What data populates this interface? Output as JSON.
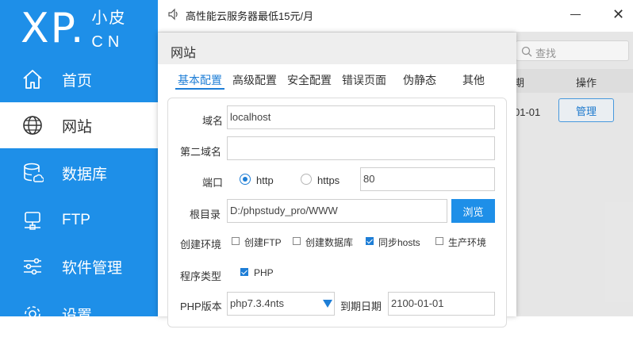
{
  "logo": {
    "main": "XP.",
    "cn_top": "小皮",
    "cn_bottom": "CN"
  },
  "sidebar": {
    "items": [
      {
        "label": "首页",
        "icon": "home-icon",
        "active": false
      },
      {
        "label": "网站",
        "icon": "globe-icon",
        "active": true
      },
      {
        "label": "数据库",
        "icon": "database-icon",
        "active": false
      },
      {
        "label": "FTP",
        "icon": "server-icon",
        "active": false
      },
      {
        "label": "软件管理",
        "icon": "sliders-icon",
        "active": false
      },
      {
        "label": "设置",
        "icon": "gear-icon",
        "active": false
      }
    ]
  },
  "topbar": {
    "notice": "高性能云服务器最低15元/月",
    "speaker_icon": "speaker-icon",
    "minimize_icon": "minimize-icon",
    "close_icon": "close-icon"
  },
  "background": {
    "search_placeholder": "查找",
    "col_date": "期",
    "col_op": "操作",
    "row_date": "01-01",
    "manage_label": "管理"
  },
  "dialog": {
    "title": "网站",
    "tabs": [
      "基本配置",
      "高级配置",
      "安全配置",
      "错误页面",
      "伪静态",
      "其他"
    ],
    "active_tab": 0,
    "form": {
      "domain_label": "域名",
      "domain_value": "localhost",
      "second_domain_label": "第二域名",
      "second_domain_value": "",
      "port_label": "端口",
      "protocol_http": "http",
      "protocol_https": "https",
      "protocol_selected": "http",
      "port_value": "80",
      "root_label": "根目录",
      "root_value": "D:/phpstudy_pro/WWW",
      "browse_label": "浏览",
      "env_label": "创建环境",
      "env_options": [
        {
          "label": "创建FTP",
          "checked": false
        },
        {
          "label": "创建数据库",
          "checked": false
        },
        {
          "label": "同步hosts",
          "checked": true
        },
        {
          "label": "生产环境",
          "checked": false
        }
      ],
      "program_label": "程序类型",
      "program_option": {
        "label": "PHP",
        "checked": true
      },
      "php_version_label": "PHP版本",
      "php_version_value": "php7.3.4nts",
      "expire_label": "到期日期",
      "expire_value": "2100-01-01"
    }
  },
  "colors": {
    "accent": "#1e8fe8",
    "link": "#1e7ed6"
  }
}
